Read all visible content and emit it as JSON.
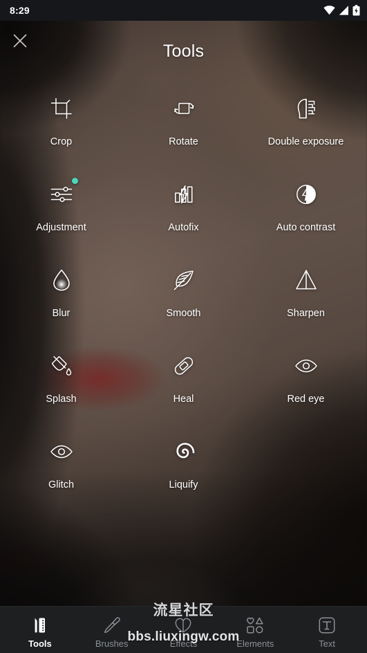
{
  "status_bar": {
    "time": "8:29",
    "icons": [
      "wifi-icon",
      "cell-signal-icon",
      "battery-charging-icon"
    ]
  },
  "header": {
    "title": "Tools",
    "close_icon": "close-icon"
  },
  "colors": {
    "accent_badge": "#4ad8bd",
    "nav_bar_background": "#1d1f21",
    "status_bar_background": "#15171a",
    "active_nav_text": "#ffffff",
    "inactive_nav_text": "#8d9094",
    "icon_stroke": "#ffffff"
  },
  "tools": [
    {
      "label": "Crop",
      "icon": "crop-icon",
      "badge": false
    },
    {
      "label": "Rotate",
      "icon": "rotate-icon",
      "badge": false
    },
    {
      "label": "Double exposure",
      "icon": "double-exposure-icon",
      "badge": false
    },
    {
      "label": "Adjustment",
      "icon": "sliders-icon",
      "badge": true
    },
    {
      "label": "Autofix",
      "icon": "autofix-icon",
      "badge": false
    },
    {
      "label": "Auto contrast",
      "icon": "auto-contrast-icon",
      "badge": false
    },
    {
      "label": "Blur",
      "icon": "blur-drop-icon",
      "badge": false
    },
    {
      "label": "Smooth",
      "icon": "feather-icon",
      "badge": false
    },
    {
      "label": "Sharpen",
      "icon": "sharpen-triangle-icon",
      "badge": false
    },
    {
      "label": "Splash",
      "icon": "paint-bucket-icon",
      "badge": false
    },
    {
      "label": "Heal",
      "icon": "bandage-icon",
      "badge": false
    },
    {
      "label": "Red eye",
      "icon": "eye-icon",
      "badge": false
    },
    {
      "label": "Glitch",
      "icon": "eye-icon",
      "badge": false
    },
    {
      "label": "Liquify",
      "icon": "spiral-icon",
      "badge": false
    }
  ],
  "bottom_nav": {
    "items": [
      {
        "label": "Tools",
        "icon": "tools-icon",
        "active": true
      },
      {
        "label": "Brushes",
        "icon": "brush-icon",
        "active": false
      },
      {
        "label": "Effects",
        "icon": "effects-icon",
        "active": false
      },
      {
        "label": "Elements",
        "icon": "elements-icon",
        "active": false
      },
      {
        "label": "Text",
        "icon": "text-icon",
        "active": false
      }
    ]
  },
  "watermark": {
    "site_name": "流星社区",
    "url": "bbs.liuxingw.com"
  }
}
